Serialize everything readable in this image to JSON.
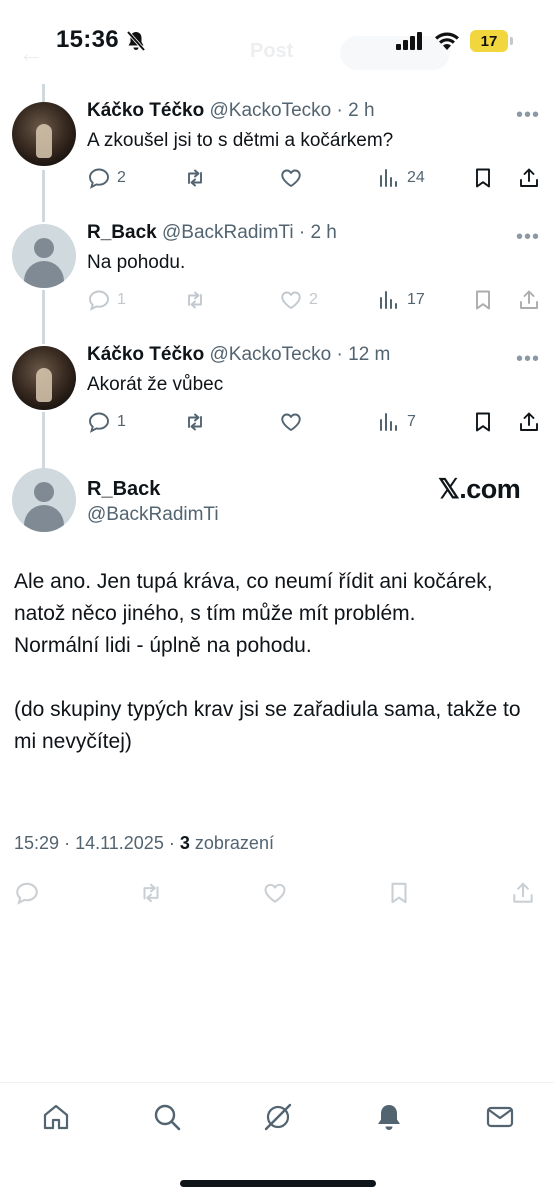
{
  "status_bar": {
    "time": "15:36",
    "battery": "17",
    "battery_color": "#f2d63d"
  },
  "header_ghost": {
    "back_icon": "arrow-left-icon",
    "title": "Post"
  },
  "thread": [
    {
      "avatar": "photo-avatar",
      "name": "Káčko Téčko",
      "handle": "@KackoTecko",
      "dot": "·",
      "ago": "2 h",
      "text": "A zkoušel jsi to s dětmi a kočárkem?",
      "replies": "2",
      "reposts": "",
      "likes": "",
      "views": "24"
    },
    {
      "avatar": "default-avatar",
      "name": "R_Back",
      "handle": "@BackRadimTi",
      "dot": "·",
      "ago": "2 h",
      "text": "Na pohodu.",
      "replies": "1",
      "reposts": "",
      "likes": "2",
      "views": "17"
    },
    {
      "avatar": "photo-avatar",
      "name": "Káčko Téčko",
      "handle": "@KackoTecko",
      "dot": "·",
      "ago": "12 m",
      "text": "Akorát že vůbec",
      "replies": "1",
      "reposts": "",
      "likes": "",
      "views": "7"
    }
  ],
  "main_tweet": {
    "name": "R_Back",
    "handle": "@BackRadimTi",
    "watermark": "𝕏.com",
    "text": "Ale ano. Jen tupá kráva, co neumí řídit ani kočárek, natož něco jiného, s tím může mít problém.\nNormální lidi - úplně na pohodu.\n\n(do skupiny typých krav jsi se zařadiula sama, takže to mi nevyčítej)",
    "time": "15:29",
    "sep1": "·",
    "date": "14.11.2025",
    "sep2": "·",
    "views_count": "3",
    "views_label": "zobrazení"
  },
  "colors": {
    "text_primary": "#0f1419",
    "text_secondary": "#536471",
    "thread_line": "#cfd9de",
    "avatar_placeholder": "#cfd9de"
  },
  "bottom_nav": [
    "home-icon",
    "search-icon",
    "grok-icon",
    "notifications-icon",
    "messages-icon"
  ]
}
